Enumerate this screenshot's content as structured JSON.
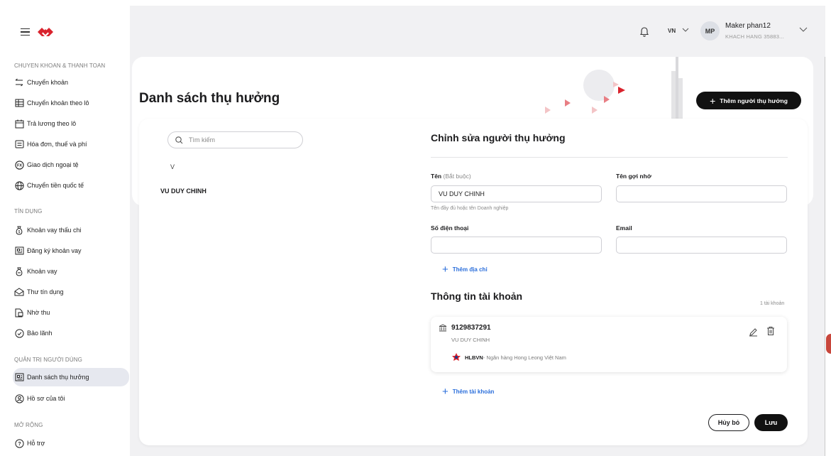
{
  "header": {
    "language": "VN",
    "user_initials": "MP",
    "user_name": "Maker phan12",
    "user_sub": "KHACH HANG 35883..."
  },
  "sidebar": {
    "sections": [
      "CHUYEN KHOAN & THANH TOAN",
      "TÍN DỤNG",
      "QUẢN TRỊ NGƯỜI DÙNG",
      "MỞ RỘNG"
    ],
    "items": [
      {
        "label": "Chuyển khoản",
        "icon": "transfer-icon"
      },
      {
        "label": "Chuyển khoản theo lô",
        "icon": "table-icon"
      },
      {
        "label": "Trả lương theo lô",
        "icon": "calendar-icon"
      },
      {
        "label": "Hóa đơn, thuế và phí",
        "icon": "bill-icon"
      },
      {
        "label": "Giao dịch ngoại tệ",
        "icon": "fx-icon"
      },
      {
        "label": "Chuyển tiền quốc tế",
        "icon": "globe-icon"
      },
      {
        "label": "Khoản vay thấu chi",
        "icon": "money-bag-icon"
      },
      {
        "label": "Đăng ký khoản vay",
        "icon": "register-icon"
      },
      {
        "label": "Khoản vay",
        "icon": "loan-icon"
      },
      {
        "label": "Thư tín dụng",
        "icon": "letter-icon"
      },
      {
        "label": "Nhờ thu",
        "icon": "document-icon"
      },
      {
        "label": "Bảo lãnh",
        "icon": "shield-check-icon"
      },
      {
        "label": "Danh sách thụ hưởng",
        "icon": "contacts-icon"
      },
      {
        "label": "Hồ sơ của tôi",
        "icon": "profile-icon"
      },
      {
        "label": "Hỗ trợ",
        "icon": "help-icon"
      }
    ]
  },
  "page": {
    "title": "Danh sách thụ hưởng",
    "add_button": "Thêm người thụ hưởng"
  },
  "list": {
    "search_placeholder": "Tìm kiếm",
    "group_letter": "V",
    "beneficiary": "VU DUY CHINH"
  },
  "form": {
    "title": "Chỉnh sửa người thụ hưởng",
    "name_label": "Tên",
    "name_required": "(Bắt buộc)",
    "name_value": "VU DUY CHINH",
    "name_hint": "Tên đầy đủ hoặc tên Doanh nghiệp",
    "nickname_label": "Tên gợi nhớ",
    "nickname_value": "",
    "phone_label": "Số điện thoại",
    "phone_value": "",
    "email_label": "Email",
    "email_value": "",
    "add_address": "Thêm địa chỉ"
  },
  "account": {
    "title": "Thông tin tài khoản",
    "count": "1 tài khoản",
    "number": "9129837291",
    "owner": "VU DUY CHINH",
    "bank_code": "HLBVN",
    "bank_name": " - Ngân hàng Hong Leong Việt Nam",
    "add_account": "Thêm tài khoản"
  },
  "actions": {
    "cancel": "Hủy bỏ",
    "save": "Lưu"
  },
  "colors": {
    "brand_red": "#d9232d",
    "link_blue": "#2a6edb",
    "dark_button": "#111111"
  }
}
